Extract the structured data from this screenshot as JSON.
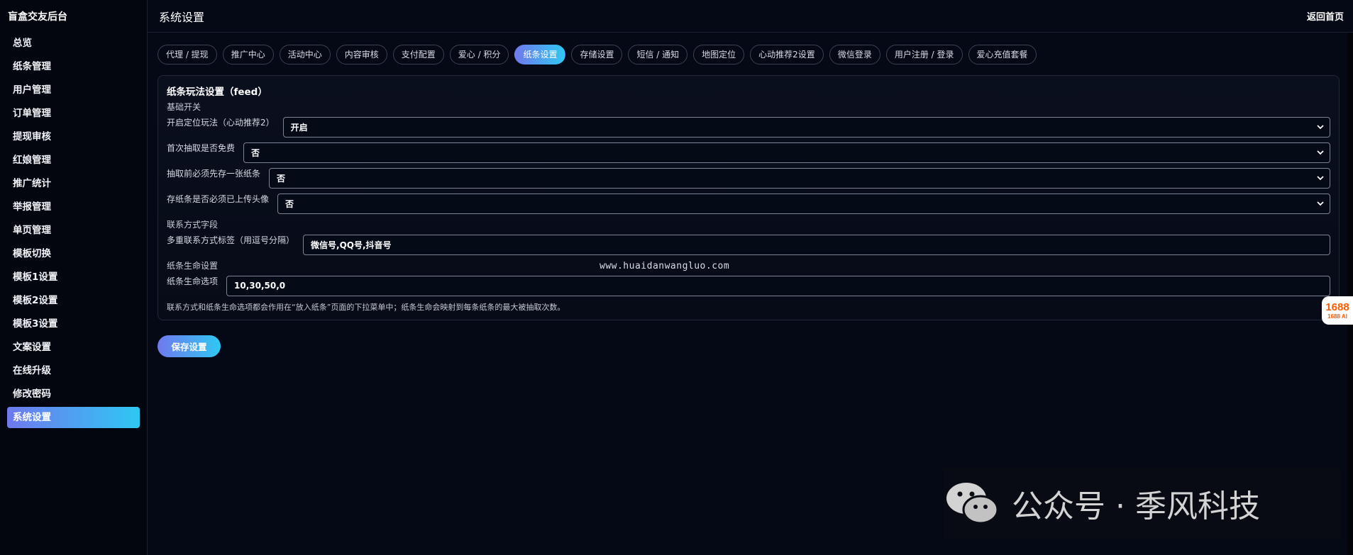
{
  "app": {
    "brand": "盲盒交友后台",
    "page_title": "系统设置",
    "home_link": "返回首页"
  },
  "sidebar": {
    "items": [
      {
        "label": "总览"
      },
      {
        "label": "纸条管理"
      },
      {
        "label": "用户管理"
      },
      {
        "label": "订单管理"
      },
      {
        "label": "提现审核"
      },
      {
        "label": "红娘管理"
      },
      {
        "label": "推广统计"
      },
      {
        "label": "举报管理"
      },
      {
        "label": "单页管理"
      },
      {
        "label": "模板切换"
      },
      {
        "label": "模板1设置"
      },
      {
        "label": "模板2设置"
      },
      {
        "label": "模板3设置"
      },
      {
        "label": "文案设置"
      },
      {
        "label": "在线升级"
      },
      {
        "label": "修改密码"
      },
      {
        "label": "系统设置",
        "active": true
      }
    ]
  },
  "tabs": [
    {
      "label": "代理 / 提现"
    },
    {
      "label": "推广中心"
    },
    {
      "label": "活动中心"
    },
    {
      "label": "内容审核"
    },
    {
      "label": "支付配置"
    },
    {
      "label": "爱心 / 积分"
    },
    {
      "label": "纸条设置",
      "active": true
    },
    {
      "label": "存储设置"
    },
    {
      "label": "短信 / 通知"
    },
    {
      "label": "地图定位"
    },
    {
      "label": "心动推荐2设置"
    },
    {
      "label": "微信登录"
    },
    {
      "label": "用户注册 / 登录"
    },
    {
      "label": "爱心充值套餐"
    }
  ],
  "panel": {
    "title": "纸条玩法设置（feed）",
    "section_basic": "基础开关",
    "fields_basic": [
      {
        "label": "开启定位玩法（心动推荐2）",
        "value": "开启"
      },
      {
        "label": "首次抽取是否免费",
        "value": "否"
      },
      {
        "label": "抽取前必须先存一张纸条",
        "value": "否"
      },
      {
        "label": "存纸条是否必须已上传头像",
        "value": "否"
      }
    ],
    "section_contact": "联系方式字段",
    "contact_field": {
      "label": "多重联系方式标签（用逗号分隔）",
      "value": "微信号,QQ号,抖音号"
    },
    "section_life": "纸条生命设置",
    "life_field": {
      "label": "纸条生命选项",
      "value": "10,30,50,0"
    },
    "hint": "联系方式和纸条生命选项都会作用在“放入纸条”页面的下拉菜单中；纸条生命会映射到每条纸条的最大被抽取次数。"
  },
  "watermark_url": "www.huaidanwangluo.com",
  "save_button": "保存设置",
  "badge": {
    "logo": "1688",
    "sub": "1688 AI"
  },
  "wechat_watermark": "公众号 · 季风科技"
}
